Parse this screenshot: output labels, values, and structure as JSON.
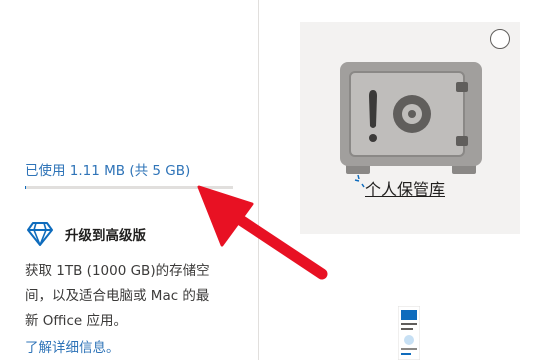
{
  "storage": {
    "used_text": "已使用 1.11 MB (共 5 GB)",
    "used_fraction": 0.0002
  },
  "upgrade": {
    "title": "升级到高级版",
    "description_lines": [
      "获取 1TB (1000 GB)的存储空",
      "间，以及适合电脑或 Mac 的最",
      "新 Office 应用。"
    ],
    "learn_more": "了解详细信息。"
  },
  "vault": {
    "label": "个人保管库"
  },
  "icons": {
    "diamond": "diamond-icon",
    "safe": "safe-icon",
    "select": "selection-circle-icon",
    "file": "document-thumbnail-icon",
    "annotation": "red-arrow"
  },
  "colors": {
    "link": "#2f74b8",
    "accent": "#0f6cbd",
    "tile_bg": "#f3f2f1",
    "safe_body": "#a19f9d",
    "annotation": "#e81123"
  }
}
